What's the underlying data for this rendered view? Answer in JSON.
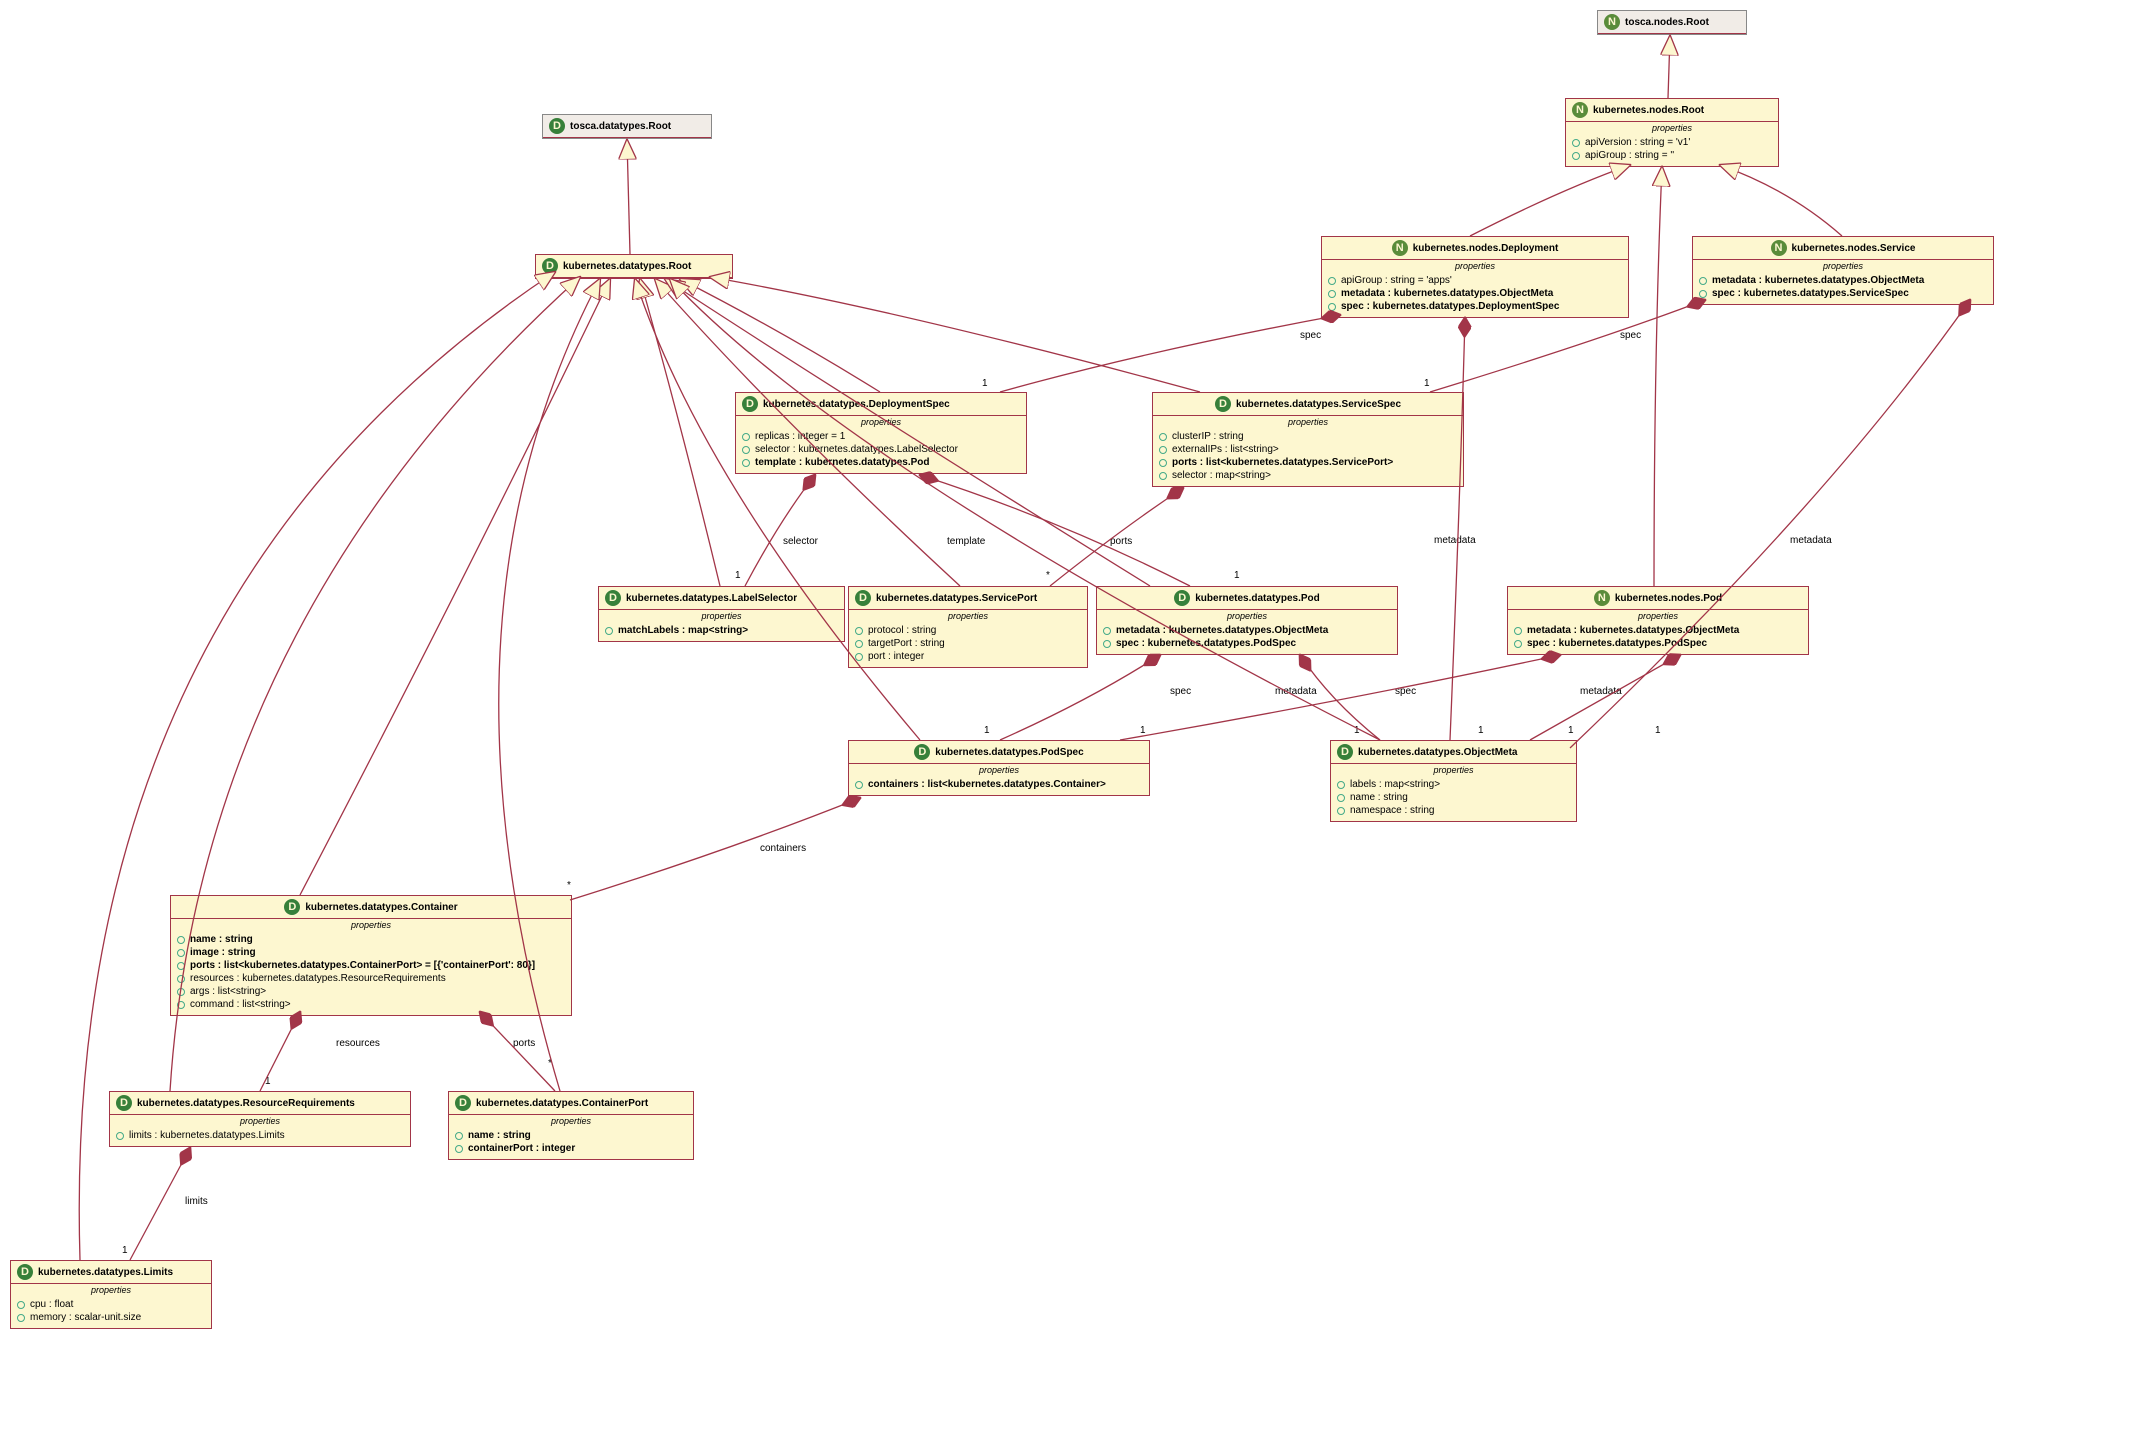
{
  "classes": {
    "toscaDRoot": {
      "icon": "D",
      "title": "tosca.datatypes.Root",
      "root": true
    },
    "toscaNRoot": {
      "icon": "N",
      "title": "tosca.nodes.Root",
      "root": true
    },
    "kDRoot": {
      "icon": "D",
      "title": "kubernetes.datatypes.Root"
    },
    "kNRoot": {
      "icon": "N",
      "title": "kubernetes.nodes.Root",
      "section": "properties",
      "props": [
        {
          "t": "apiVersion : string = 'v1'"
        },
        {
          "t": "apiGroup : string = ''"
        }
      ]
    },
    "kNDeploy": {
      "icon": "N",
      "title": "kubernetes.nodes.Deployment",
      "section": "properties",
      "props": [
        {
          "t": "apiGroup : string = 'apps'"
        },
        {
          "t": "metadata : kubernetes.datatypes.ObjectMeta",
          "r": 1
        },
        {
          "t": "spec : kubernetes.datatypes.DeploymentSpec",
          "r": 1
        }
      ]
    },
    "kNService": {
      "icon": "N",
      "title": "kubernetes.nodes.Service",
      "section": "properties",
      "props": [
        {
          "t": "metadata : kubernetes.datatypes.ObjectMeta",
          "r": 1
        },
        {
          "t": "spec : kubernetes.datatypes.ServiceSpec",
          "r": 1
        }
      ]
    },
    "kDDeploySpec": {
      "icon": "D",
      "title": "kubernetes.datatypes.DeploymentSpec",
      "section": "properties",
      "props": [
        {
          "t": "replicas : integer = 1"
        },
        {
          "t": "selector : kubernetes.datatypes.LabelSelector"
        },
        {
          "t": "template : kubernetes.datatypes.Pod",
          "r": 1
        }
      ]
    },
    "kDServiceSpec": {
      "icon": "D",
      "title": "kubernetes.datatypes.ServiceSpec",
      "section": "properties",
      "props": [
        {
          "t": "clusterIP : string"
        },
        {
          "t": "externalIPs : list<string>"
        },
        {
          "t": "ports : list<kubernetes.datatypes.ServicePort>",
          "r": 1
        },
        {
          "t": "selector : map<string>"
        }
      ]
    },
    "kDLabelSel": {
      "icon": "D",
      "title": "kubernetes.datatypes.LabelSelector",
      "section": "properties",
      "props": [
        {
          "t": "matchLabels : map<string>",
          "r": 1
        }
      ]
    },
    "kDServicePort": {
      "icon": "D",
      "title": "kubernetes.datatypes.ServicePort",
      "section": "properties",
      "props": [
        {
          "t": "protocol : string"
        },
        {
          "t": "targetPort : string"
        },
        {
          "t": "port : integer"
        }
      ]
    },
    "kDPod": {
      "icon": "D",
      "title": "kubernetes.datatypes.Pod",
      "section": "properties",
      "props": [
        {
          "t": "metadata : kubernetes.datatypes.ObjectMeta",
          "r": 1
        },
        {
          "t": "spec : kubernetes.datatypes.PodSpec",
          "r": 1
        }
      ]
    },
    "kNPod": {
      "icon": "N",
      "title": "kubernetes.nodes.Pod",
      "section": "properties",
      "props": [
        {
          "t": "metadata : kubernetes.datatypes.ObjectMeta",
          "r": 1
        },
        {
          "t": "spec : kubernetes.datatypes.PodSpec",
          "r": 1
        }
      ]
    },
    "kDPodSpec": {
      "icon": "D",
      "title": "kubernetes.datatypes.PodSpec",
      "section": "properties",
      "props": [
        {
          "t": "containers : list<kubernetes.datatypes.Container>",
          "r": 1
        }
      ]
    },
    "kDObjMeta": {
      "icon": "D",
      "title": "kubernetes.datatypes.ObjectMeta",
      "section": "properties",
      "props": [
        {
          "t": "labels : map<string>"
        },
        {
          "t": "name : string"
        },
        {
          "t": "namespace : string"
        }
      ]
    },
    "kDContainer": {
      "icon": "D",
      "title": "kubernetes.datatypes.Container",
      "section": "properties",
      "props": [
        {
          "t": "name : string",
          "r": 1
        },
        {
          "t": "image : string",
          "r": 1
        },
        {
          "t": "ports : list<kubernetes.datatypes.ContainerPort> = [{'containerPort': 80}]",
          "r": 1
        },
        {
          "t": "resources : kubernetes.datatypes.ResourceRequirements"
        },
        {
          "t": "args : list<string>"
        },
        {
          "t": "command : list<string>"
        }
      ]
    },
    "kDResReq": {
      "icon": "D",
      "title": "kubernetes.datatypes.ResourceRequirements",
      "section": "properties",
      "props": [
        {
          "t": "limits : kubernetes.datatypes.Limits"
        }
      ]
    },
    "kDContPort": {
      "icon": "D",
      "title": "kubernetes.datatypes.ContainerPort",
      "section": "properties",
      "props": [
        {
          "t": "name : string",
          "r": 1
        },
        {
          "t": "containerPort : integer",
          "r": 1
        }
      ]
    },
    "kDLimits": {
      "icon": "D",
      "title": "kubernetes.datatypes.Limits",
      "section": "properties",
      "props": [
        {
          "t": "cpu : float"
        },
        {
          "t": "memory : scalar-unit.size"
        }
      ]
    }
  },
  "labels": {
    "spec": "spec",
    "metadata": "metadata",
    "selector": "selector",
    "template": "template",
    "ports": "ports",
    "containers": "containers",
    "resources": "resources",
    "limits": "limits",
    "one": "1",
    "star": "*"
  }
}
